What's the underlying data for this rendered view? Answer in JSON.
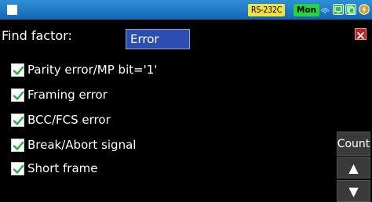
{
  "status_bar": {
    "port_badge": "RS-232C",
    "mode_badge": "Mon",
    "icons": [
      "window-icon",
      "signal-icon",
      "screen-icon",
      "copy-icon",
      "power-icon"
    ]
  },
  "find_factor": {
    "label": "Find factor:",
    "selected": "Error"
  },
  "checkboxes": [
    {
      "label": "Parity error/MP bit='1'",
      "checked": true
    },
    {
      "label": "Framing error",
      "checked": true
    },
    {
      "label": "BCC/FCS error",
      "checked": true
    },
    {
      "label": "Break/Abort signal",
      "checked": true
    },
    {
      "label": "Short frame",
      "checked": true
    }
  ],
  "side_buttons": {
    "count_label": "Count",
    "up_glyph": "▲",
    "down_glyph": "▼"
  },
  "colors": {
    "titlebar": "#1e78c8",
    "check": "#2ea84a",
    "select_bg": "#2a4fb0",
    "close_red": "#b7262a"
  }
}
